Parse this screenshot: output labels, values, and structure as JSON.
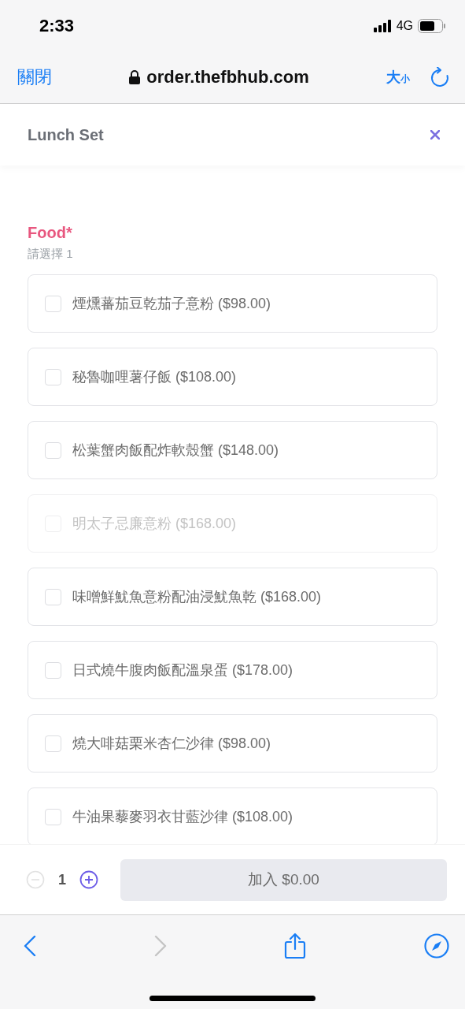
{
  "status_bar": {
    "time": "2:33",
    "network": "4G"
  },
  "browser": {
    "close": "關閉",
    "url": "order.thefbhub.com",
    "text_size": "大",
    "text_size_small": "小",
    "back_disabled": false,
    "forward_disabled": true
  },
  "modal": {
    "title": "Lunch Set"
  },
  "section": {
    "title": "Food",
    "required_mark": "*",
    "hint": "請選擇 1",
    "options": [
      {
        "label": "煙燻蕃茄豆乾茄子意粉 ($98.00)",
        "checked": false,
        "disabled": false
      },
      {
        "label": "秘魯咖哩薯仔飯 ($108.00)",
        "checked": false,
        "disabled": false
      },
      {
        "label": "松葉蟹肉飯配炸軟殼蟹 ($148.00)",
        "checked": false,
        "disabled": false
      },
      {
        "label": "明太子忌廉意粉 ($168.00)",
        "checked": false,
        "disabled": true
      },
      {
        "label": "味噌鮮魷魚意粉配油浸魷魚乾 ($168.00)",
        "checked": false,
        "disabled": false
      },
      {
        "label": "日式燒牛腹肉飯配溫泉蛋 ($178.00)",
        "checked": false,
        "disabled": false
      },
      {
        "label": "燒大啡菇栗米杏仁沙律 ($98.00)",
        "checked": false,
        "disabled": false
      },
      {
        "label": "牛油果藜麥羽衣甘藍沙律 ($108.00)",
        "checked": false,
        "disabled": false
      }
    ]
  },
  "footer": {
    "quantity": "1",
    "decrease_disabled": true,
    "increase_disabled": false,
    "add_button": "加入 $0.00"
  }
}
